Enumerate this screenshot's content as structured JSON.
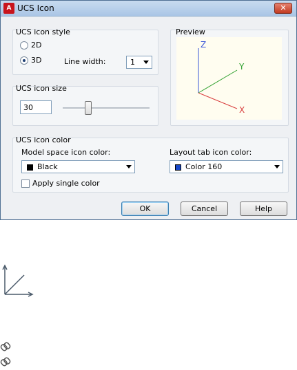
{
  "window": {
    "title": "UCS Icon",
    "app_icon_text": "A",
    "close_glyph": "✕"
  },
  "style_group": {
    "label": "UCS icon style",
    "options": [
      "2D",
      "3D"
    ],
    "selected": "3D",
    "line_width_label": "Line width:",
    "line_width_value": "1"
  },
  "preview": {
    "label": "Preview",
    "axes": {
      "x": "X",
      "y": "Y",
      "z": "Z"
    },
    "colors": {
      "x": "#d83c3c",
      "y": "#2ea02e",
      "z": "#3a56d8",
      "bg": "#fffdf0"
    }
  },
  "size_group": {
    "label": "UCS icon size",
    "value": "30"
  },
  "color_group": {
    "label": "UCS icon color",
    "model_label": "Model space icon color:",
    "model_value": "Black",
    "model_swatch": "#000000",
    "layout_label": "Layout tab icon color:",
    "layout_value": "Color 160",
    "layout_swatch": "#1848c8",
    "apply_single": "Apply single color",
    "apply_single_checked": false
  },
  "buttons": {
    "ok": "OK",
    "cancel": "Cancel",
    "help": "Help"
  },
  "desktop": {
    "ucs_glyph_color": "#4a5a6a",
    "icon_glyph": "🔗"
  }
}
